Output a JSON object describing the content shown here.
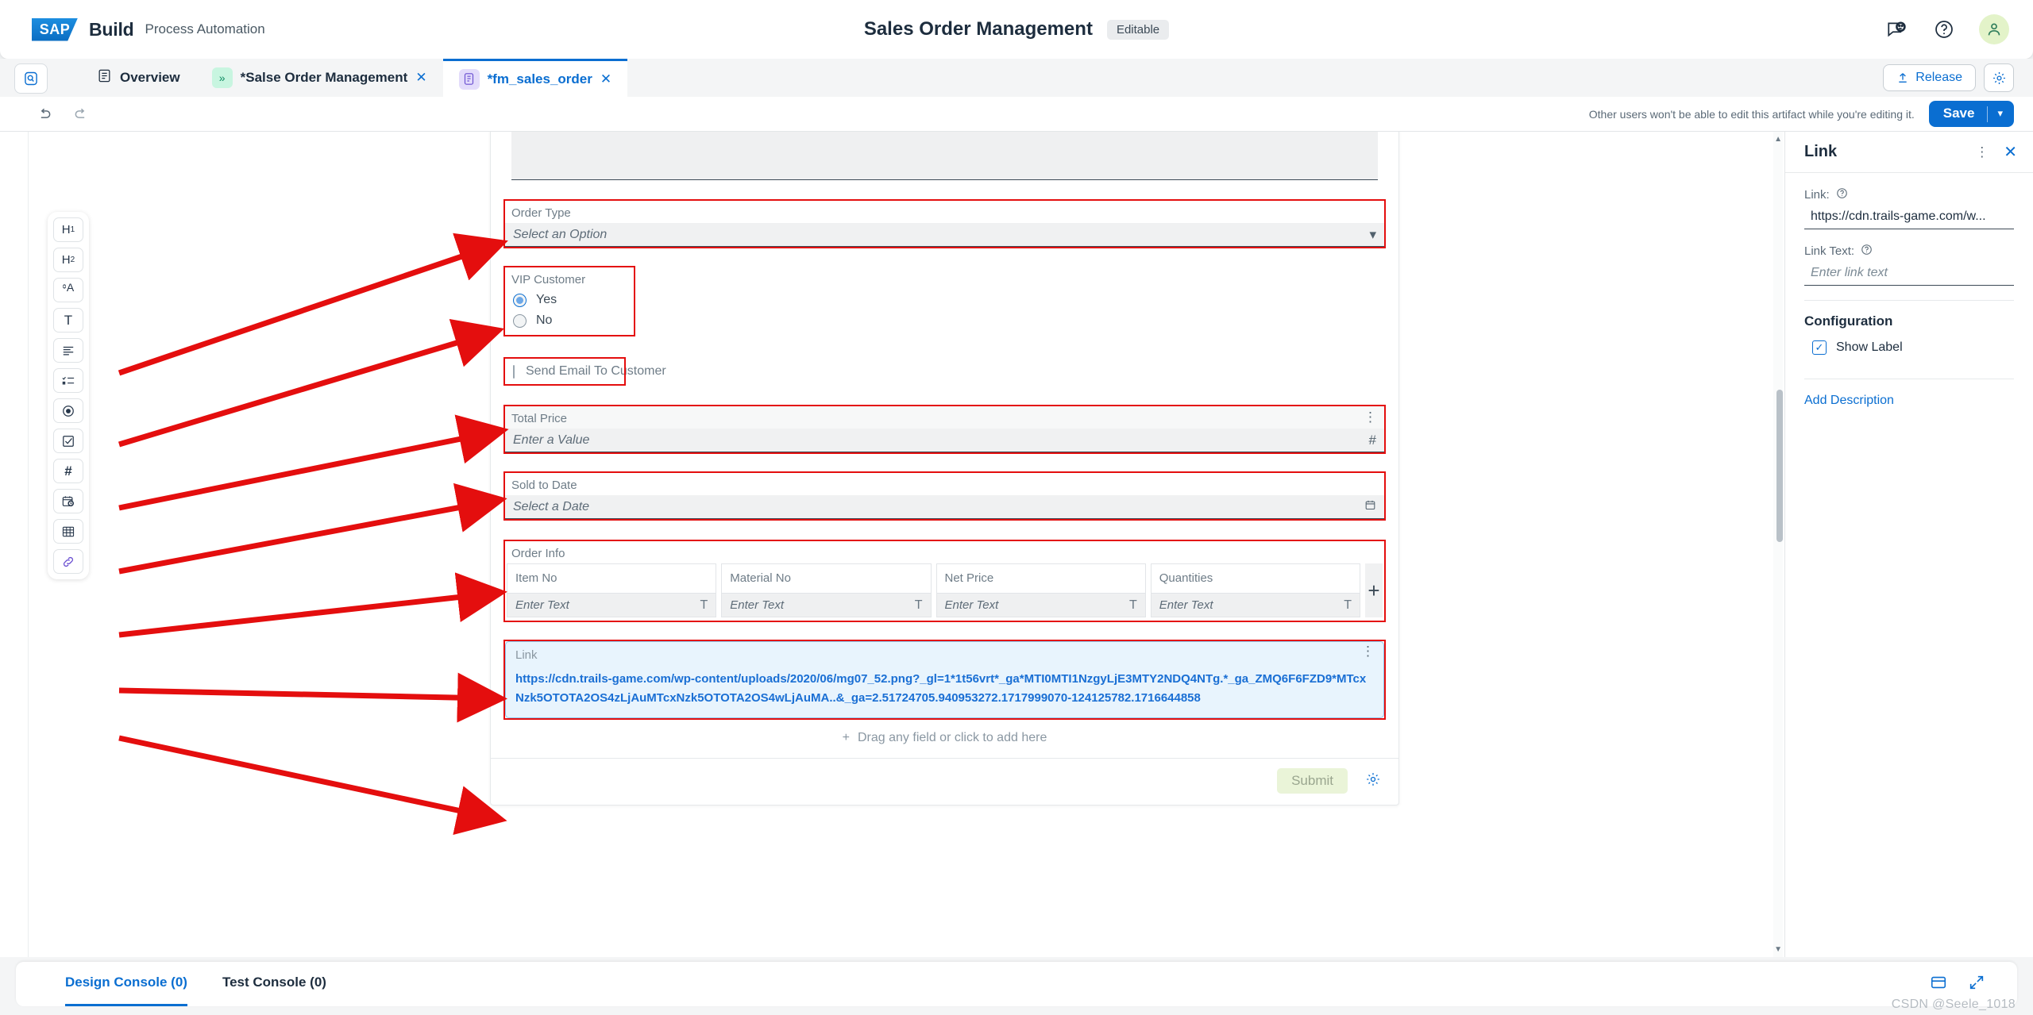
{
  "shell": {
    "logo_text": "SAP",
    "product": "Build",
    "product_sub": "Process Automation",
    "title": "Sales Order Management",
    "status_badge": "Editable",
    "icons": [
      "feedback-icon",
      "help-icon",
      "user-avatar-icon"
    ]
  },
  "tabs": {
    "home_icon": "search-artifact-icon",
    "items": [
      {
        "label": "Overview",
        "icon": "overview-icon",
        "closable": false,
        "active": false
      },
      {
        "label": "*Salse Order Management",
        "icon": "process-icon",
        "closable": true,
        "active": false
      },
      {
        "label": "*fm_sales_order",
        "icon": "form-icon",
        "closable": true,
        "active": true
      }
    ],
    "release_label": "Release",
    "settings_icon": "gear-icon"
  },
  "editor_toolbar": {
    "undo_icon": "undo-icon",
    "redo_icon": "redo-icon",
    "lock_hint": "Other users won't be able to edit this artifact while you're editing it.",
    "save_label": "Save",
    "save_caret": "⌄"
  },
  "palette": {
    "items": [
      {
        "name": "heading-1",
        "glyph": "H₁"
      },
      {
        "name": "heading-2",
        "glyph": "H₂"
      },
      {
        "name": "paragraph",
        "glyph": "ᴬA"
      },
      {
        "name": "text-field",
        "glyph": "T"
      },
      {
        "name": "text-area",
        "glyph": "☰"
      },
      {
        "name": "list-field",
        "glyph": "≣"
      },
      {
        "name": "radio-group",
        "glyph": "◉"
      },
      {
        "name": "checkbox-field",
        "glyph": "☑"
      },
      {
        "name": "number-field",
        "glyph": "#"
      },
      {
        "name": "date-field",
        "glyph": "Ὄ5"
      },
      {
        "name": "table-field",
        "glyph": "☷"
      },
      {
        "name": "link-field",
        "glyph": "ὑ7"
      }
    ]
  },
  "form": {
    "fields": [
      {
        "type": "select",
        "label": "Order Type",
        "placeholder": "Select an Option",
        "highlight": true,
        "tail_icon": "chevron-down-icon"
      },
      {
        "type": "radio",
        "label": "VIP Customer",
        "highlight": true,
        "options": [
          {
            "label": "Yes",
            "selected": true
          },
          {
            "label": "No",
            "selected": false
          }
        ]
      },
      {
        "type": "checkbox",
        "label": "Send Email To Customer",
        "checked": false,
        "highlight": true
      },
      {
        "type": "number",
        "label": "Total Price",
        "placeholder": "Enter a Value",
        "highlight": true,
        "tail_icon": "hash-icon"
      },
      {
        "type": "date",
        "label": "Sold to Date",
        "placeholder": "Select a Date",
        "highlight": true,
        "tail_icon": "calendar-icon"
      }
    ],
    "table": {
      "label": "Order Info",
      "highlight": true,
      "columns": [
        "Item No",
        "Material No",
        "Net Price",
        "Quantities"
      ],
      "cell_placeholder": "Enter Text",
      "cell_type_icon": "T",
      "add_row_label": "+"
    },
    "link_widget": {
      "label": "Link",
      "highlight": true,
      "selected": true,
      "url": "https://cdn.trails-game.com/wp-content/uploads/2020/06/mg07_52.png?_gl=1*1t56vrt*_ga*MTI0MTI1NzgyLjE3MTY2NDQ4NTg.*_ga_ZMQ6F6FZD9*MTcxNzk5OTOTA2OS4zLjAuMTcxNzk5OTOTA2OS4wLjAuMA..&_ga=2.51724705.940953272.1717999070-124125782.1716644858",
      "kebab_icon": "more-options-icon"
    },
    "drop_hint": "Drag any field or click to add here",
    "drop_hint_icon": "plus-icon",
    "submit_label": "Submit",
    "settings_icon": "gear-icon"
  },
  "properties": {
    "title": "Link",
    "kebab_icon": "more-options-icon",
    "close_icon": "close-icon",
    "link_label": "Link:",
    "link_help_icon": "help-circle-icon",
    "link_value": "https://cdn.trails-game.com/w...",
    "link_text_label": "Link Text:",
    "link_text_help_icon": "help-circle-icon",
    "link_text_placeholder": "Enter link text",
    "configuration_title": "Configuration",
    "show_label_text": "Show Label",
    "show_label_checked": true,
    "add_description": "Add Description"
  },
  "bottom": {
    "tabs": [
      {
        "label": "Design Console (0)",
        "active": true
      },
      {
        "label": "Test Console (0)",
        "active": false
      }
    ],
    "icons": [
      "panel-layout-icon",
      "expand-icon"
    ]
  },
  "watermark": "CSDN @Seele_1018",
  "colors": {
    "accent_blue": "#0a6ed1",
    "highlight_red": "#e40e0e",
    "selected_bg": "#e8f4fd",
    "text_dark": "#1d2d3e"
  }
}
